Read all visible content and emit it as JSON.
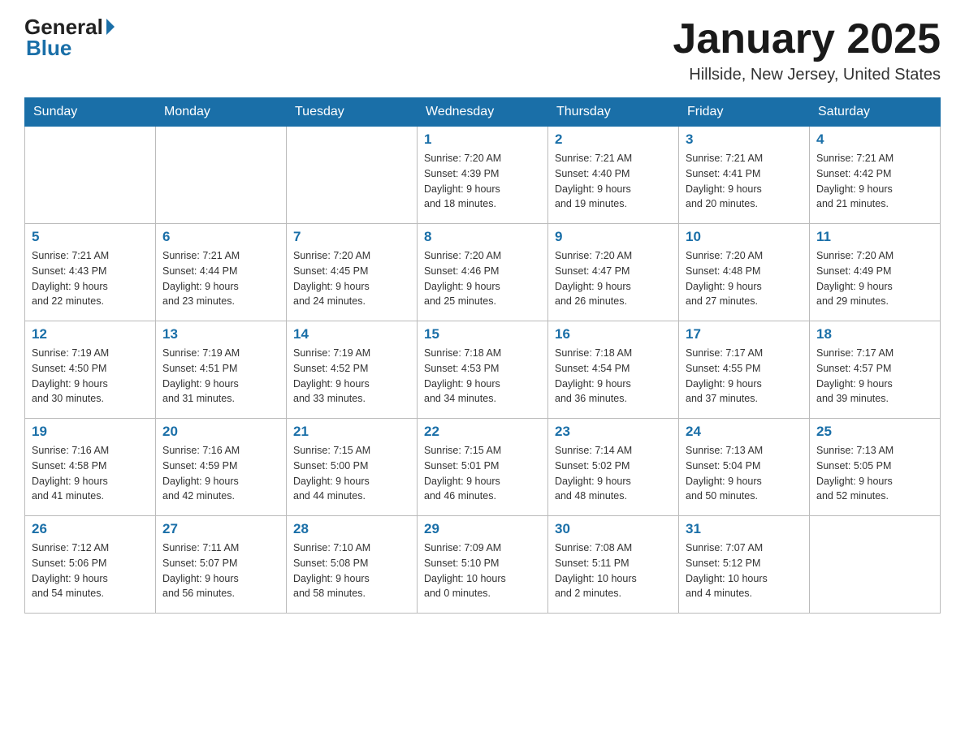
{
  "header": {
    "logo_general": "General",
    "logo_blue": "Blue",
    "month_title": "January 2025",
    "location": "Hillside, New Jersey, United States"
  },
  "days_of_week": [
    "Sunday",
    "Monday",
    "Tuesday",
    "Wednesday",
    "Thursday",
    "Friday",
    "Saturday"
  ],
  "weeks": [
    [
      {
        "day": "",
        "info": ""
      },
      {
        "day": "",
        "info": ""
      },
      {
        "day": "",
        "info": ""
      },
      {
        "day": "1",
        "info": "Sunrise: 7:20 AM\nSunset: 4:39 PM\nDaylight: 9 hours\nand 18 minutes."
      },
      {
        "day": "2",
        "info": "Sunrise: 7:21 AM\nSunset: 4:40 PM\nDaylight: 9 hours\nand 19 minutes."
      },
      {
        "day": "3",
        "info": "Sunrise: 7:21 AM\nSunset: 4:41 PM\nDaylight: 9 hours\nand 20 minutes."
      },
      {
        "day": "4",
        "info": "Sunrise: 7:21 AM\nSunset: 4:42 PM\nDaylight: 9 hours\nand 21 minutes."
      }
    ],
    [
      {
        "day": "5",
        "info": "Sunrise: 7:21 AM\nSunset: 4:43 PM\nDaylight: 9 hours\nand 22 minutes."
      },
      {
        "day": "6",
        "info": "Sunrise: 7:21 AM\nSunset: 4:44 PM\nDaylight: 9 hours\nand 23 minutes."
      },
      {
        "day": "7",
        "info": "Sunrise: 7:20 AM\nSunset: 4:45 PM\nDaylight: 9 hours\nand 24 minutes."
      },
      {
        "day": "8",
        "info": "Sunrise: 7:20 AM\nSunset: 4:46 PM\nDaylight: 9 hours\nand 25 minutes."
      },
      {
        "day": "9",
        "info": "Sunrise: 7:20 AM\nSunset: 4:47 PM\nDaylight: 9 hours\nand 26 minutes."
      },
      {
        "day": "10",
        "info": "Sunrise: 7:20 AM\nSunset: 4:48 PM\nDaylight: 9 hours\nand 27 minutes."
      },
      {
        "day": "11",
        "info": "Sunrise: 7:20 AM\nSunset: 4:49 PM\nDaylight: 9 hours\nand 29 minutes."
      }
    ],
    [
      {
        "day": "12",
        "info": "Sunrise: 7:19 AM\nSunset: 4:50 PM\nDaylight: 9 hours\nand 30 minutes."
      },
      {
        "day": "13",
        "info": "Sunrise: 7:19 AM\nSunset: 4:51 PM\nDaylight: 9 hours\nand 31 minutes."
      },
      {
        "day": "14",
        "info": "Sunrise: 7:19 AM\nSunset: 4:52 PM\nDaylight: 9 hours\nand 33 minutes."
      },
      {
        "day": "15",
        "info": "Sunrise: 7:18 AM\nSunset: 4:53 PM\nDaylight: 9 hours\nand 34 minutes."
      },
      {
        "day": "16",
        "info": "Sunrise: 7:18 AM\nSunset: 4:54 PM\nDaylight: 9 hours\nand 36 minutes."
      },
      {
        "day": "17",
        "info": "Sunrise: 7:17 AM\nSunset: 4:55 PM\nDaylight: 9 hours\nand 37 minutes."
      },
      {
        "day": "18",
        "info": "Sunrise: 7:17 AM\nSunset: 4:57 PM\nDaylight: 9 hours\nand 39 minutes."
      }
    ],
    [
      {
        "day": "19",
        "info": "Sunrise: 7:16 AM\nSunset: 4:58 PM\nDaylight: 9 hours\nand 41 minutes."
      },
      {
        "day": "20",
        "info": "Sunrise: 7:16 AM\nSunset: 4:59 PM\nDaylight: 9 hours\nand 42 minutes."
      },
      {
        "day": "21",
        "info": "Sunrise: 7:15 AM\nSunset: 5:00 PM\nDaylight: 9 hours\nand 44 minutes."
      },
      {
        "day": "22",
        "info": "Sunrise: 7:15 AM\nSunset: 5:01 PM\nDaylight: 9 hours\nand 46 minutes."
      },
      {
        "day": "23",
        "info": "Sunrise: 7:14 AM\nSunset: 5:02 PM\nDaylight: 9 hours\nand 48 minutes."
      },
      {
        "day": "24",
        "info": "Sunrise: 7:13 AM\nSunset: 5:04 PM\nDaylight: 9 hours\nand 50 minutes."
      },
      {
        "day": "25",
        "info": "Sunrise: 7:13 AM\nSunset: 5:05 PM\nDaylight: 9 hours\nand 52 minutes."
      }
    ],
    [
      {
        "day": "26",
        "info": "Sunrise: 7:12 AM\nSunset: 5:06 PM\nDaylight: 9 hours\nand 54 minutes."
      },
      {
        "day": "27",
        "info": "Sunrise: 7:11 AM\nSunset: 5:07 PM\nDaylight: 9 hours\nand 56 minutes."
      },
      {
        "day": "28",
        "info": "Sunrise: 7:10 AM\nSunset: 5:08 PM\nDaylight: 9 hours\nand 58 minutes."
      },
      {
        "day": "29",
        "info": "Sunrise: 7:09 AM\nSunset: 5:10 PM\nDaylight: 10 hours\nand 0 minutes."
      },
      {
        "day": "30",
        "info": "Sunrise: 7:08 AM\nSunset: 5:11 PM\nDaylight: 10 hours\nand 2 minutes."
      },
      {
        "day": "31",
        "info": "Sunrise: 7:07 AM\nSunset: 5:12 PM\nDaylight: 10 hours\nand 4 minutes."
      },
      {
        "day": "",
        "info": ""
      }
    ]
  ]
}
